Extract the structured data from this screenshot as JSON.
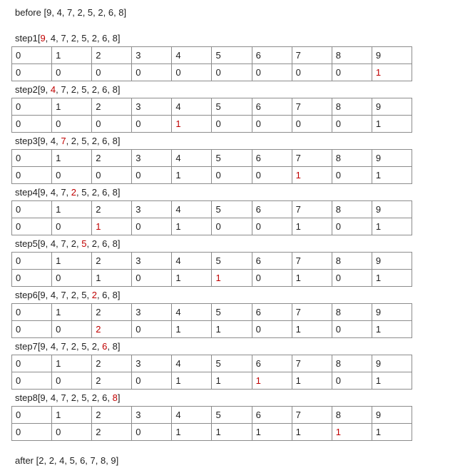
{
  "before": {
    "label": "before",
    "array": "[9, 4, 7, 2, 5, 2, 6, 8]"
  },
  "after": {
    "label": "after",
    "array": "[2, 2, 4, 5, 6, 7, 8, 9]"
  },
  "colors": {
    "text": "#1f1f1f",
    "highlight": "#c00000",
    "border": "#8c8c8c"
  },
  "steps": [
    {
      "label": "step1",
      "array_parts": [
        "[",
        "9",
        ", 4, 7, 2, 5, 2, 6, 8]"
      ],
      "indices": [
        "0",
        "1",
        "2",
        "3",
        "4",
        "5",
        "6",
        "7",
        "8",
        "9"
      ],
      "counts": [
        "0",
        "0",
        "0",
        "0",
        "0",
        "0",
        "0",
        "0",
        "0",
        "1"
      ],
      "highlight_index": 9
    },
    {
      "label": "step2",
      "array_parts": [
        "[9, ",
        "4",
        ", 7, 2, 5, 2, 6, 8]"
      ],
      "indices": [
        "0",
        "1",
        "2",
        "3",
        "4",
        "5",
        "6",
        "7",
        "8",
        "9"
      ],
      "counts": [
        "0",
        "0",
        "0",
        "0",
        "1",
        "0",
        "0",
        "0",
        "0",
        "1"
      ],
      "highlight_index": 4
    },
    {
      "label": "step3",
      "array_parts": [
        "[9, 4, ",
        "7",
        ", 2, 5, 2, 6, 8]"
      ],
      "indices": [
        "0",
        "1",
        "2",
        "3",
        "4",
        "5",
        "6",
        "7",
        "8",
        "9"
      ],
      "counts": [
        "0",
        "0",
        "0",
        "0",
        "1",
        "0",
        "0",
        "1",
        "0",
        "1"
      ],
      "highlight_index": 7
    },
    {
      "label": "step4",
      "array_parts": [
        "[9, 4, 7, ",
        "2",
        ", 5, 2, 6, 8]"
      ],
      "indices": [
        "0",
        "1",
        "2",
        "3",
        "4",
        "5",
        "6",
        "7",
        "8",
        "9"
      ],
      "counts": [
        "0",
        "0",
        "1",
        "0",
        "1",
        "0",
        "0",
        "1",
        "0",
        "1"
      ],
      "highlight_index": 2
    },
    {
      "label": "step5",
      "array_parts": [
        "[9, 4, 7, 2, ",
        "5",
        ", 2, 6, 8]"
      ],
      "indices": [
        "0",
        "1",
        "2",
        "3",
        "4",
        "5",
        "6",
        "7",
        "8",
        "9"
      ],
      "counts": [
        "0",
        "0",
        "1",
        "0",
        "1",
        "1",
        "0",
        "1",
        "0",
        "1"
      ],
      "highlight_index": 5
    },
    {
      "label": "step6",
      "array_parts": [
        "[9, 4, 7, 2, 5, ",
        "2",
        ", 6, 8]"
      ],
      "indices": [
        "0",
        "1",
        "2",
        "3",
        "4",
        "5",
        "6",
        "7",
        "8",
        "9"
      ],
      "counts": [
        "0",
        "0",
        "2",
        "0",
        "1",
        "1",
        "0",
        "1",
        "0",
        "1"
      ],
      "highlight_index": 2
    },
    {
      "label": "step7",
      "array_parts": [
        "[9, 4, 7, 2, 5, 2, ",
        "6",
        ", 8]"
      ],
      "indices": [
        "0",
        "1",
        "2",
        "3",
        "4",
        "5",
        "6",
        "7",
        "8",
        "9"
      ],
      "counts": [
        "0",
        "0",
        "2",
        "0",
        "1",
        "1",
        "1",
        "1",
        "0",
        "1"
      ],
      "highlight_index": 6
    },
    {
      "label": "step8",
      "array_parts": [
        "[9, 4, 7, 2, 5, 2, 6, ",
        "8",
        "]"
      ],
      "indices": [
        "0",
        "1",
        "2",
        "3",
        "4",
        "5",
        "6",
        "7",
        "8",
        "9"
      ],
      "counts": [
        "0",
        "0",
        "2",
        "0",
        "1",
        "1",
        "1",
        "1",
        "1",
        "1"
      ],
      "highlight_index": 8
    }
  ]
}
